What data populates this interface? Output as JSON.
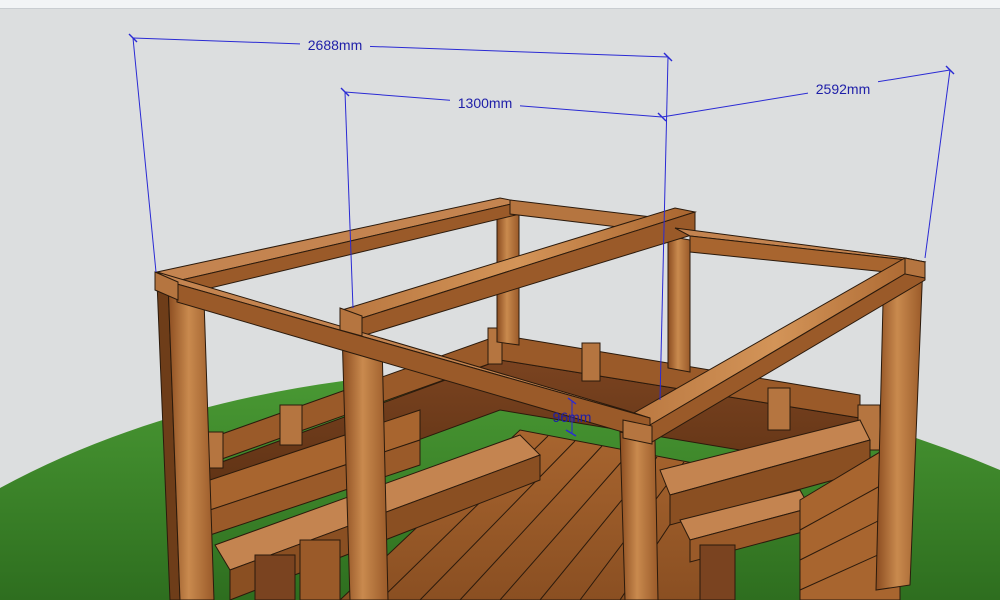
{
  "app": {
    "name": "3D modeling viewport",
    "render_style": "shaded with textures"
  },
  "scene": {
    "subject": "timber pergola frame over a bench deck",
    "ground_color": "#3d8a2a",
    "sky_color": "#dcdedf",
    "wood_light": "#c98a4e",
    "wood_mid": "#a8652f",
    "wood_dark": "#6e3d19"
  },
  "dimensions": {
    "overall_width": {
      "label": "2688mm"
    },
    "inner_span": {
      "label": "1300mm"
    },
    "depth": {
      "label": "2592mm"
    },
    "beam_thickness": {
      "label": "96mm"
    }
  },
  "colors": {
    "dimension": "#2a2ad4",
    "dimension_text": "#1e1ea8",
    "edge": "#2b1a0c"
  }
}
